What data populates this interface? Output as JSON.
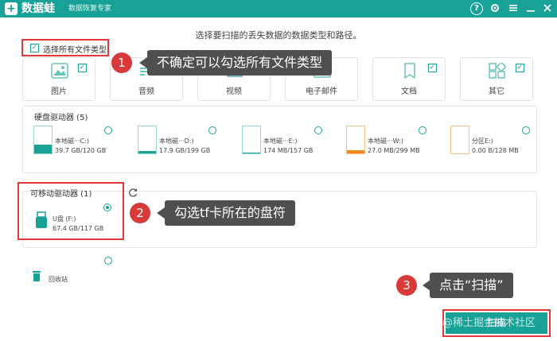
{
  "app": {
    "name": "数据蛙",
    "subtitle": "数据恢复专家",
    "logo_glyph": "+"
  },
  "titlebar_icons": [
    "help-icon",
    "settings-icon",
    "menu-icon",
    "minimize-icon",
    "close-icon"
  ],
  "prompt": "选择要扫描的丢失数据的数据类型和路径。",
  "select_all": {
    "label": "选择所有文件类型",
    "checked": true
  },
  "file_types": [
    {
      "label": "图片",
      "icon": "image-icon",
      "checked": true
    },
    {
      "label": "音频",
      "icon": "audio-icon",
      "checked": false
    },
    {
      "label": "视频",
      "icon": "video-icon",
      "checked": false
    },
    {
      "label": "电子邮件",
      "icon": "email-icon",
      "checked": false
    },
    {
      "label": "文档",
      "icon": "document-icon",
      "checked": true
    },
    {
      "label": "其它",
      "icon": "other-icon",
      "checked": true
    }
  ],
  "hard_disk": {
    "title": "硬盘驱动器 (5)",
    "drives": [
      {
        "name": "本地磁···C:)",
        "size": "39.7 GB/120 GB",
        "fill_color": "#17a197",
        "fill_fraction": 0.3
      },
      {
        "name": "本地磁···D:)",
        "size": "17.9 GB/199 GB",
        "fill_color": "#17a197",
        "fill_fraction": 0.08
      },
      {
        "name": "本地磁···E:)",
        "size": "174 MB/157 GB",
        "fill_color": "#17a197",
        "fill_fraction": 0.02
      },
      {
        "name": "本地磁···W:)",
        "size": "27.0 MB/299 MB",
        "fill_color": "#f08a1c",
        "fill_fraction": 0.1
      },
      {
        "name": "分区E:)",
        "size": "0.00  B/128 MB",
        "fill_color": "#f08a1c",
        "fill_fraction": 0.0
      }
    ]
  },
  "removable": {
    "title": "可移动驱动器 (1)",
    "drive": {
      "name": "U盘 (F:)",
      "size": "67.4 GB/117 GB",
      "selected": true
    }
  },
  "recycle": {
    "label": "回收站"
  },
  "callouts": [
    {
      "number": "1",
      "text": "不确定可以勾选所有文件类型"
    },
    {
      "number": "2",
      "text": "勾选tf卡所在的盘符"
    },
    {
      "number": "3",
      "text": "点击“扫描”"
    }
  ],
  "scan_button": {
    "label": "扫描"
  },
  "watermark": "@稀土掘金技术社区"
}
